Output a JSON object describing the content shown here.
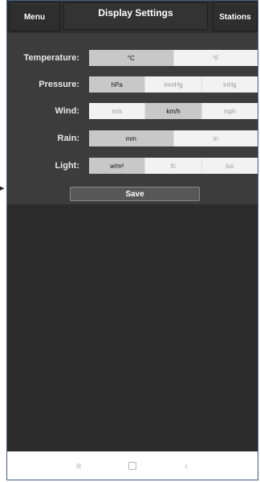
{
  "header": {
    "menu_label": "Menu",
    "title": "Display Settings",
    "stations_label": "Stations"
  },
  "settings": [
    {
      "label": "Temperature:",
      "options": [
        "°C",
        "°F"
      ],
      "selected": 0
    },
    {
      "label": "Pressure:",
      "options": [
        "hPa",
        "mmHg",
        "inHg"
      ],
      "selected": 0
    },
    {
      "label": "Wind:",
      "options": [
        "m/s",
        "km/h",
        "mph"
      ],
      "selected": 1
    },
    {
      "label": "Rain:",
      "options": [
        "mm",
        "in"
      ],
      "selected": 0
    },
    {
      "label": "Light:",
      "options": [
        "w/m²",
        "fc",
        "lux"
      ],
      "selected": 0
    }
  ],
  "save_label": "Save",
  "navbar": {
    "icons": [
      "recent-apps-icon",
      "home-icon",
      "back-icon"
    ]
  },
  "colors": {
    "background": "#2b2b2b",
    "panel": "#3c3c3c",
    "segment_selected": "#c8c8c8",
    "segment_unselected": "#f2f2f2",
    "frame_border": "#3d5f87"
  }
}
